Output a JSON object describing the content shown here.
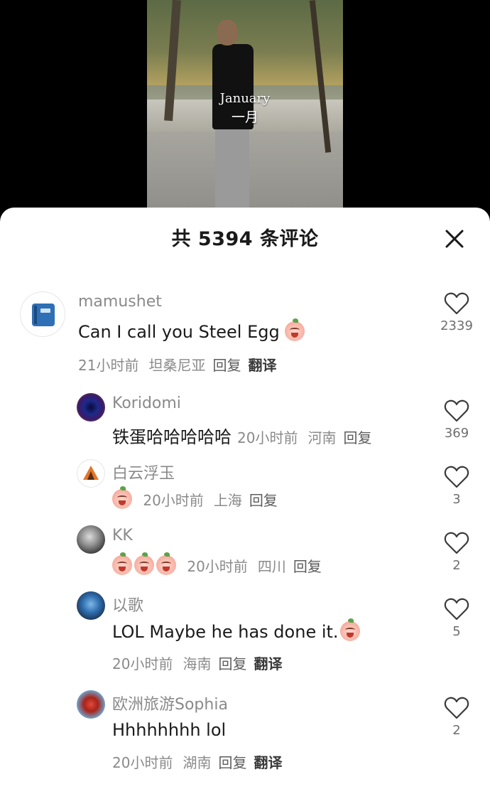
{
  "video": {
    "caption_en": "January",
    "caption_zh": "一月"
  },
  "sheet": {
    "title": "共 5394 条评论"
  },
  "comments": [
    {
      "username": "mamushet",
      "text": "Can I call you Steel Egg",
      "time": "21小时前",
      "location": "坦桑尼亚",
      "reply_label": "回复",
      "translate_label": "翻译",
      "likes": "2339",
      "avatar": "blue-book-avatar"
    },
    {
      "username": "Koridomi",
      "text": "铁蛋哈哈哈哈哈",
      "time": "20小时前",
      "location": "河南",
      "reply_label": "回复",
      "likes": "369",
      "avatar": "dark-blue-swirl-avatar"
    },
    {
      "username": "白云浮玉",
      "time": "20小时前",
      "location": "上海",
      "reply_label": "回复",
      "likes": "3",
      "avatar": "orange-tent-avatar"
    },
    {
      "username": "KK",
      "time": "20小时前",
      "location": "四川",
      "reply_label": "回复",
      "likes": "2",
      "avatar": "grayscale-person-avatar"
    },
    {
      "username": "以歌",
      "text": "LOL  Maybe he has done it.",
      "time": "20小时前",
      "location": "海南",
      "reply_label": "回复",
      "translate_label": "翻译",
      "likes": "5",
      "avatar": "blue-figure-avatar"
    },
    {
      "username": "欧洲旅游Sophia",
      "text": "Hhhhhhhh lol",
      "time": "20小时前",
      "location": "湖南",
      "reply_label": "回复",
      "translate_label": "翻译",
      "likes": "2",
      "avatar": "red-hood-avatar"
    }
  ],
  "icons": {
    "close": "close-icon",
    "like": "heart-outline-icon",
    "emoji": "crying-peach-emoji"
  },
  "colors": {
    "sheet_bg": "#ffffff",
    "text_primary": "#1a1a1a",
    "text_secondary": "#8a8a8a",
    "page_bg": "#000000"
  }
}
